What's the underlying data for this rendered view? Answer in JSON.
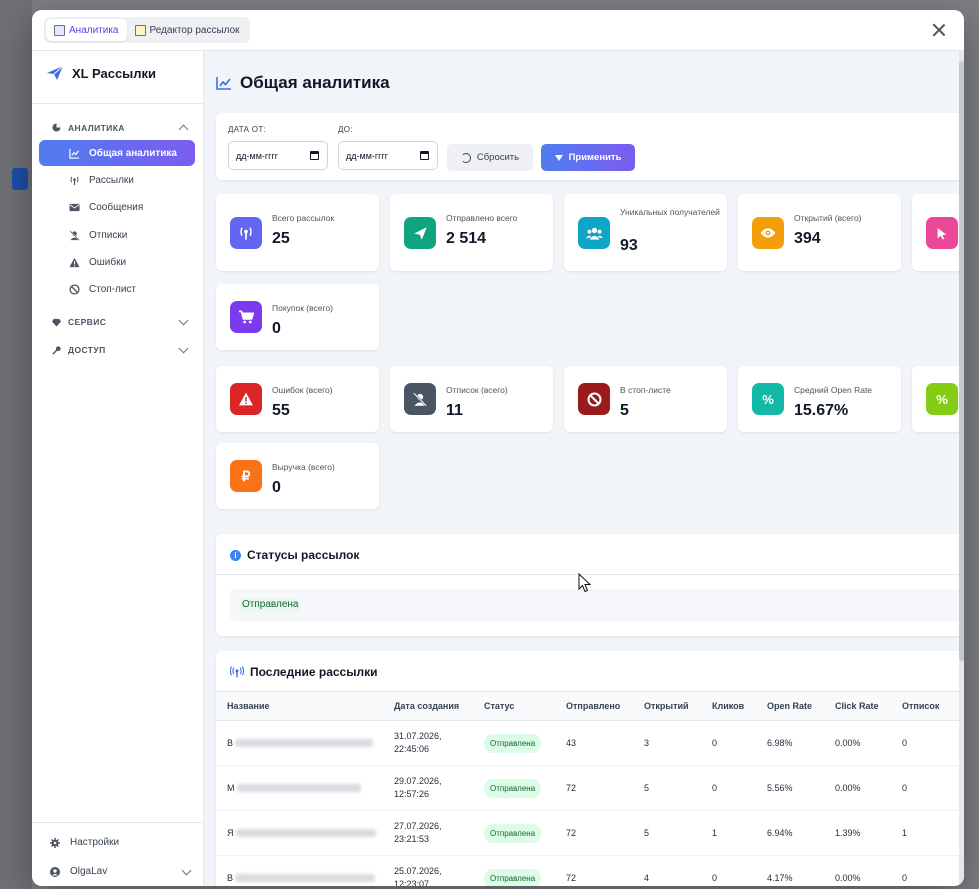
{
  "tabs": [
    {
      "label": "Аналитика",
      "active": true
    },
    {
      "label": "Редактор рассылок",
      "active": false
    }
  ],
  "brand": {
    "name": "XL Рассылки"
  },
  "sidebar": {
    "sections": [
      {
        "label": "АНАЛИТИКА",
        "icon": "pie-chart-icon",
        "expanded": true
      },
      {
        "label": "СЕРВИС",
        "icon": "gem-icon",
        "expanded": false
      },
      {
        "label": "ДОСТУП",
        "icon": "key-icon",
        "expanded": false
      }
    ],
    "items": [
      {
        "label": "Общая аналитика",
        "icon": "line-chart-icon",
        "active": true
      },
      {
        "label": "Рассылки",
        "icon": "antenna-icon"
      },
      {
        "label": "Сообщения",
        "icon": "envelope-icon"
      },
      {
        "label": "Отписки",
        "icon": "user-slash-icon"
      },
      {
        "label": "Ошибки",
        "icon": "warning-icon"
      },
      {
        "label": "Стоп-лист",
        "icon": "ban-icon"
      }
    ],
    "settings": "Настройки",
    "user": "OlgaLav"
  },
  "page": {
    "title": "Общая аналитика"
  },
  "filters": {
    "date_from_label": "ДАТА ОТ:",
    "date_to_label": "ДО:",
    "date_from_value": "дд-мм-гггг",
    "date_to_value": "дд-мм-гггг",
    "reset_label": "Сбросить",
    "apply_label": "Применить"
  },
  "stats": [
    {
      "label": "Всего рассылок",
      "value": "25",
      "color": "#6366f1",
      "icon": "antenna-icon"
    },
    {
      "label": "Отправлено всего",
      "value": "2 514",
      "color": "#10a37f",
      "icon": "paper-plane-icon"
    },
    {
      "label": "Уникальных получателей",
      "value": "93",
      "color": "#0ea5c6",
      "icon": "users-icon"
    },
    {
      "label": "Открытий (всего)",
      "value": "394",
      "color": "#f59e0b",
      "icon": "eye-icon"
    },
    {
      "label": "",
      "value": "",
      "color": "#ec4899",
      "icon": "pointer-icon"
    },
    {
      "label": "Покупок (всего)",
      "value": "0",
      "color": "#7c3aed",
      "icon": "cart-icon"
    },
    {
      "label": "Ошибок (всего)",
      "value": "55",
      "color": "#dc2626",
      "icon": "warning-icon"
    },
    {
      "label": "Отписок (всего)",
      "value": "11",
      "color": "#4b5563",
      "icon": "user-slash-icon"
    },
    {
      "label": "В стоп-листе",
      "value": "5",
      "color": "#991b1b",
      "icon": "ban-icon"
    },
    {
      "label": "Средний Open Rate",
      "value": "15.67%",
      "color": "#14b8a6",
      "icon": "percent-icon"
    },
    {
      "label": "",
      "value": "",
      "color": "#84cc16",
      "icon": "percent-icon"
    },
    {
      "label": "Выручка (всего)",
      "value": "0",
      "color": "#f97316",
      "icon": "ruble-icon"
    }
  ],
  "statuses": {
    "title": "Статусы рассылок",
    "tags": [
      "Отправлена"
    ]
  },
  "recent": {
    "title": "Последние рассылки",
    "columns": [
      "Название",
      "Дата создания",
      "Статус",
      "Отправлено",
      "Открытий",
      "Кликов",
      "Open Rate",
      "Click Rate",
      "Отписок"
    ],
    "rows": [
      {
        "name": "В",
        "date": "31.07.2026,",
        "time": "22:45:06",
        "status": "Отправлена",
        "sent": "43",
        "opens": "3",
        "clicks": "0",
        "open_rate": "6.98%",
        "click_rate": "0.00%",
        "unsub": "0"
      },
      {
        "name": "М",
        "date": "29.07.2026,",
        "time": "12:57:26",
        "status": "Отправлена",
        "sent": "72",
        "opens": "5",
        "clicks": "0",
        "open_rate": "5.56%",
        "click_rate": "0.00%",
        "unsub": "0"
      },
      {
        "name": "Я",
        "date": "27.07.2026,",
        "time": "23:21:53",
        "status": "Отправлена",
        "sent": "72",
        "opens": "5",
        "clicks": "1",
        "open_rate": "6.94%",
        "click_rate": "1.39%",
        "unsub": "1"
      },
      {
        "name": "В",
        "date": "25.07.2026,",
        "time": "12:23:07",
        "status": "Отправлена",
        "sent": "72",
        "opens": "4",
        "clicks": "0",
        "open_rate": "4.17%",
        "click_rate": "0.00%",
        "unsub": "0"
      }
    ]
  }
}
